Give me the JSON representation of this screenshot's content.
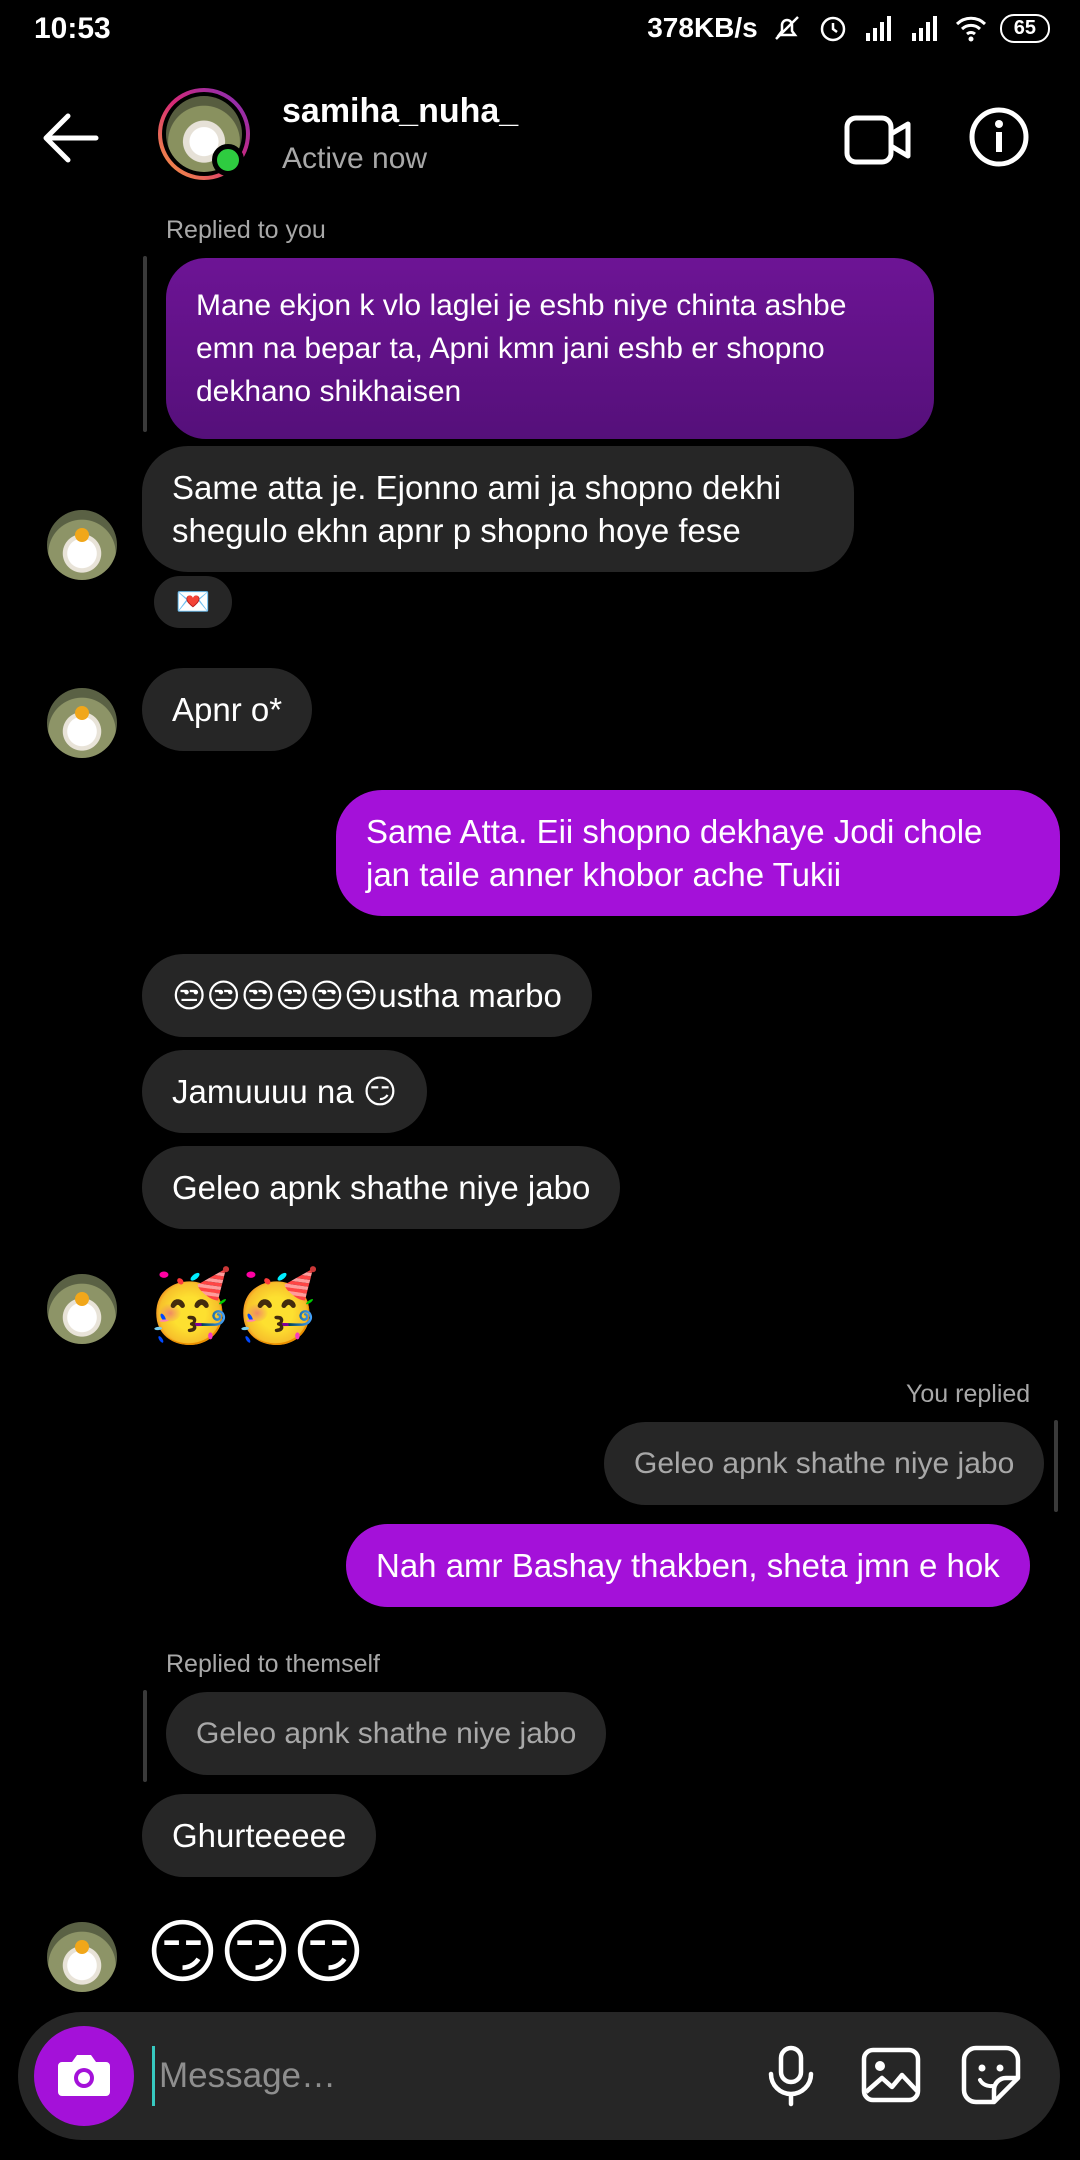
{
  "status_bar": {
    "time": "10:53",
    "network_speed": "378KB/s",
    "battery": "65",
    "icons": [
      "mute-icon",
      "alarm-icon",
      "signal-icon",
      "signal-icon",
      "wifi-icon",
      "battery-icon"
    ]
  },
  "header": {
    "username": "samiha_nuha_",
    "status": "Active now",
    "icons": [
      "back-arrow-icon",
      "video-call-icon",
      "info-icon"
    ]
  },
  "messages": [
    {
      "meta": "Replied to you",
      "text": "Mane ekjon k vlo laglei je eshb niye chinta ashbe emn na bepar ta, Apni kmn jani eshb er shopno dekhano shikhaisen"
    },
    {
      "text": "Same atta je. Ejonno ami ja shopno dekhi shegulo ekhn apnr p shopno hoye fese",
      "reaction": "💌"
    },
    {
      "text": "Apnr o*"
    },
    {
      "text": "Same Atta. Eii shopno dekhaye Jodi chole jan taile anner khobor ache Tukii"
    },
    {
      "text": "😒😒😒😒😒😒ustha marbo"
    },
    {
      "text": "Jamuuuu na 😏"
    },
    {
      "text": "Geleo apnk shathe niye jabo"
    },
    {
      "text": "🥳🥳"
    },
    {
      "meta": "You replied",
      "quoted": "Geleo apnk shathe niye jabo",
      "text": "Nah amr Bashay thakben, sheta jmn e hok"
    },
    {
      "meta": "Replied to themself",
      "quoted": "Geleo apnk shathe niye jabo",
      "text": "Ghurteeeee"
    },
    {
      "text": "😏😏😏"
    }
  ],
  "composer": {
    "placeholder": "Message…",
    "icons": [
      "camera-icon",
      "microphone-icon",
      "gallery-icon",
      "sticker-icon"
    ]
  },
  "colors": {
    "background": "#000000",
    "incoming_bubble": "#262626",
    "outgoing_bubble": "#a411d9",
    "replied_bubble": "#5a0f7e",
    "active_dot": "#2ecc40"
  }
}
